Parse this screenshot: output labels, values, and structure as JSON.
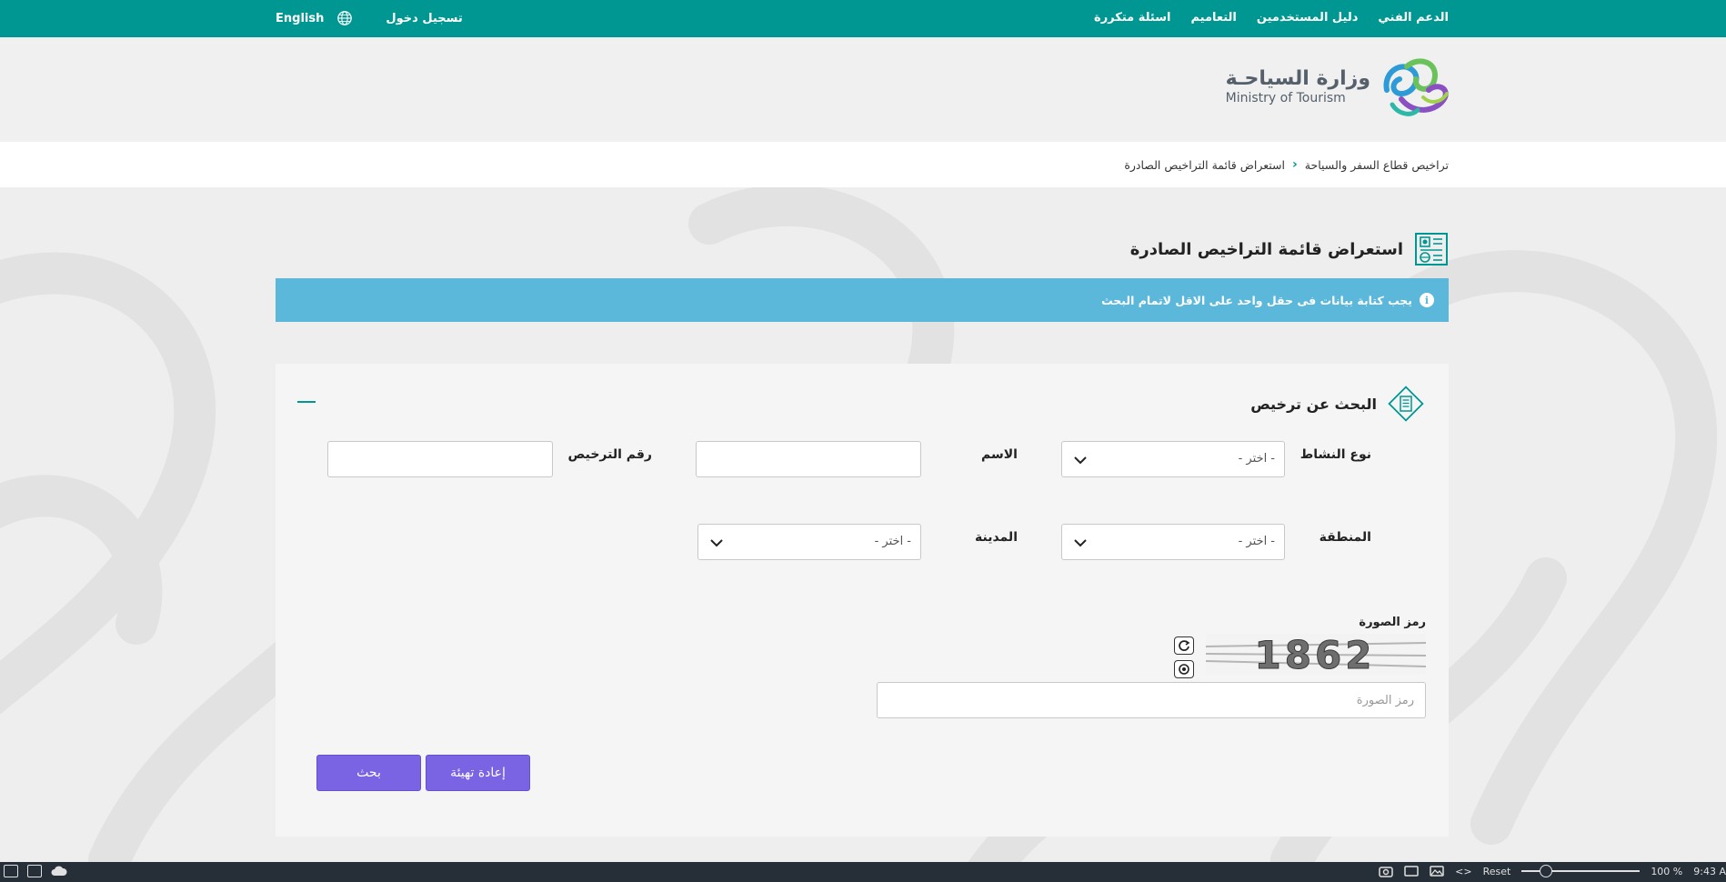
{
  "topbar": {
    "nav": [
      {
        "label": "اسئلة متكررة"
      },
      {
        "label": "التعاميم"
      },
      {
        "label": "دليل المستخدمين"
      },
      {
        "label": "الدعم الفني"
      }
    ],
    "login": "تسجيل دخول",
    "language": "English"
  },
  "logo": {
    "arabic": "وزارة السياحـة",
    "english": "Ministry of Tourism"
  },
  "breadcrumb": {
    "root": "تراخيص قطاع السفر والسياحة",
    "current": "استعراض قائمة التراخيص الصادرة"
  },
  "page": {
    "title": "استعراض قائمة التراخيص الصادرة"
  },
  "alert": {
    "message": "يجب كتابة بيانات فى حقل واحد على الاقل لاتمام البحث"
  },
  "search": {
    "title": "البحث عن ترخيص",
    "fields": {
      "activity_type": {
        "label": "نوع النشاط",
        "value": "- اختر -"
      },
      "name": {
        "label": "الاسم",
        "value": ""
      },
      "license_number": {
        "label": "رقم الترخيص",
        "value": ""
      },
      "region": {
        "label": "المنطقة",
        "value": "- اختر -"
      },
      "city": {
        "label": "المدينة",
        "value": "- اختر -"
      }
    },
    "captcha": {
      "label": "رمز الصورة",
      "image_text": "1862",
      "placeholder": "رمز الصورة"
    },
    "buttons": {
      "search": "بحث",
      "reset": "إعادة تهيئة"
    }
  },
  "taskbar": {
    "reset": "Reset",
    "zoom": "100 %",
    "time": "9:43 A"
  },
  "colors": {
    "teal": "#009792",
    "alert": "#5bb8db",
    "button": "#7b64e3"
  }
}
